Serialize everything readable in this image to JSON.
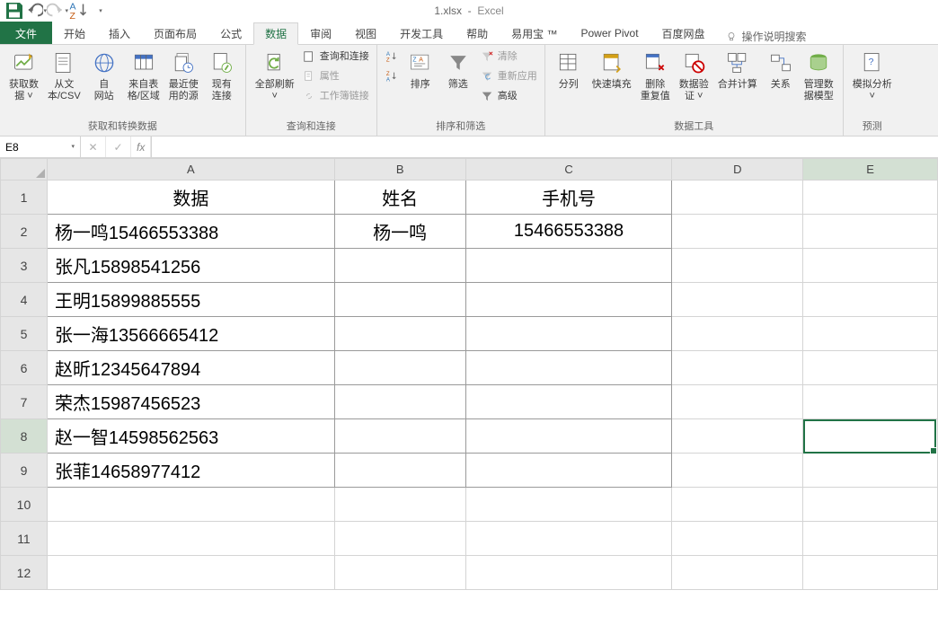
{
  "app": {
    "filename": "1.xlsx",
    "appname": "Excel"
  },
  "qat": {
    "save": "save-icon",
    "undo": "undo-icon",
    "redo": "redo-icon",
    "sort": "sort-icon"
  },
  "tabs": {
    "file": "文件",
    "items": [
      "开始",
      "插入",
      "页面布局",
      "公式",
      "数据",
      "审阅",
      "视图",
      "开发工具",
      "帮助",
      "易用宝 ™",
      "Power Pivot",
      "百度网盘"
    ],
    "active": "数据",
    "tell": "操作说明搜索"
  },
  "ribbon": {
    "g1": {
      "label": "获取和转换数据",
      "get": "获取数\n据 ˅",
      "csv": "从文\n本/CSV",
      "web": "自\n网站",
      "table": "来自表\n格/区域",
      "recent": "最近使\n用的源",
      "existing": "现有\n连接"
    },
    "g2": {
      "label": "查询和连接",
      "refresh": "全部刷新\n˅",
      "queries": "查询和连接",
      "props": "属性",
      "links": "工作簿链接"
    },
    "g3": {
      "label": "排序和筛选",
      "az": "A↓Z",
      "za": "Z↓A",
      "sort": "排序",
      "filter": "筛选",
      "clear": "清除",
      "reapply": "重新应用",
      "advanced": "高级"
    },
    "g4": {
      "label": "数据工具",
      "ttc": "分列",
      "flash": "快速填充",
      "dedup": "删除\n重复值",
      "valid": "数据验\n证 ˅",
      "consol": "合并计算",
      "rel": "关系",
      "dm": "管理数\n据模型"
    },
    "g5": {
      "label": "预测",
      "whatif": "模拟分析\n˅"
    }
  },
  "formula_bar": {
    "name": "E8",
    "fx": "fx",
    "value": ""
  },
  "columns": [
    "A",
    "B",
    "C",
    "D",
    "E"
  ],
  "rows": [
    "1",
    "2",
    "3",
    "4",
    "5",
    "6",
    "7",
    "8",
    "9",
    "10",
    "11",
    "12"
  ],
  "headers": {
    "A": "数据",
    "B": "姓名",
    "C": "手机号"
  },
  "data": [
    {
      "A": "杨一鸣15466553388",
      "B": "杨一鸣",
      "C": "15466553388"
    },
    {
      "A": "张凡15898541256",
      "B": "",
      "C": ""
    },
    {
      "A": "王明15899885555",
      "B": "",
      "C": ""
    },
    {
      "A": "张一海13566665412",
      "B": "",
      "C": ""
    },
    {
      "A": "赵昕12345647894",
      "B": "",
      "C": ""
    },
    {
      "A": "荣杰15987456523",
      "B": "",
      "C": ""
    },
    {
      "A": "赵一智14598562563",
      "B": "",
      "C": ""
    },
    {
      "A": "张菲14658977412",
      "B": "",
      "C": ""
    }
  ],
  "selection": {
    "cell": "E8"
  }
}
